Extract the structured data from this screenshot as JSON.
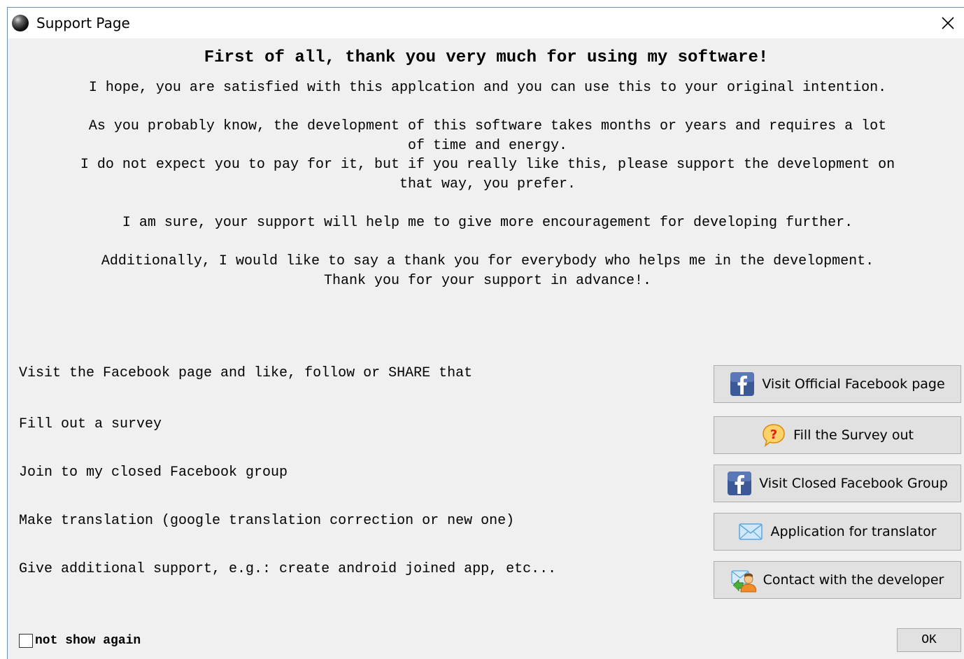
{
  "window": {
    "title": "Support Page",
    "close_icon": "close-icon",
    "app_icon": "app-icon"
  },
  "content": {
    "heading": "First of all, thank you very much for using my software!",
    "paragraphs": [
      "I hope, you are satisfied with this applcation and you can use this to your original intention.",
      "As you probably know, the development of this software takes months or years and requires a lot\nof time and energy.",
      "I do not expect you to pay for it, but if you really like this, please support the development on\nthat way, you prefer.",
      "I am sure, your support will help me to give more encouragement for developing further.",
      "Additionally, I would like to say a thank you for everybody who helps me in the development.\nThank you for your support in advance!."
    ]
  },
  "rows": [
    {
      "label": "Visit the Facebook page and like, follow or SHARE that",
      "button": "Visit Official Facebook page",
      "icon": "facebook-icon"
    },
    {
      "label": "Fill out a survey",
      "button": "Fill the Survey out",
      "icon": "question-icon"
    },
    {
      "label": "Join to my closed Facebook group",
      "button": "Visit Closed Facebook Group",
      "icon": "facebook-icon"
    },
    {
      "label": "Make translation (google translation correction or new one)",
      "button": "Application for translator",
      "icon": "envelope-icon"
    },
    {
      "label": "Give additional support, e.g.: create android joined app, etc...",
      "button": "Contact with the developer",
      "icon": "contact-icon"
    }
  ],
  "footer": {
    "checkbox_label": "not show again",
    "checkbox_checked": false,
    "ok_label": "OK"
  },
  "colors": {
    "facebook_blue": "#3b5998",
    "window_bg": "#f0f0f0",
    "button_bg": "#e1e1e1"
  }
}
